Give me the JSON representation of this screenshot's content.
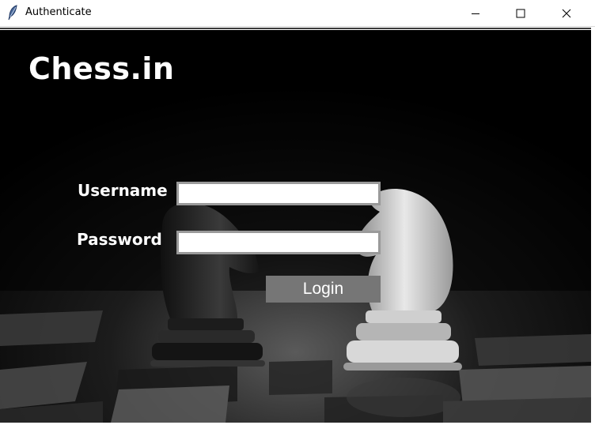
{
  "window": {
    "title": "Authenticate",
    "icon": "feather-icon",
    "controls": [
      "minimize-icon",
      "maximize-icon",
      "close-icon"
    ]
  },
  "app": {
    "brand": "Chess.in"
  },
  "form": {
    "username_label": "Username",
    "username_value": "",
    "password_label": "Password",
    "password_value": "",
    "login_label": "Login"
  },
  "colors": {
    "background": "#000000",
    "text": "#ffffff",
    "button": "#767676",
    "field_border": "#9a9a9a"
  }
}
